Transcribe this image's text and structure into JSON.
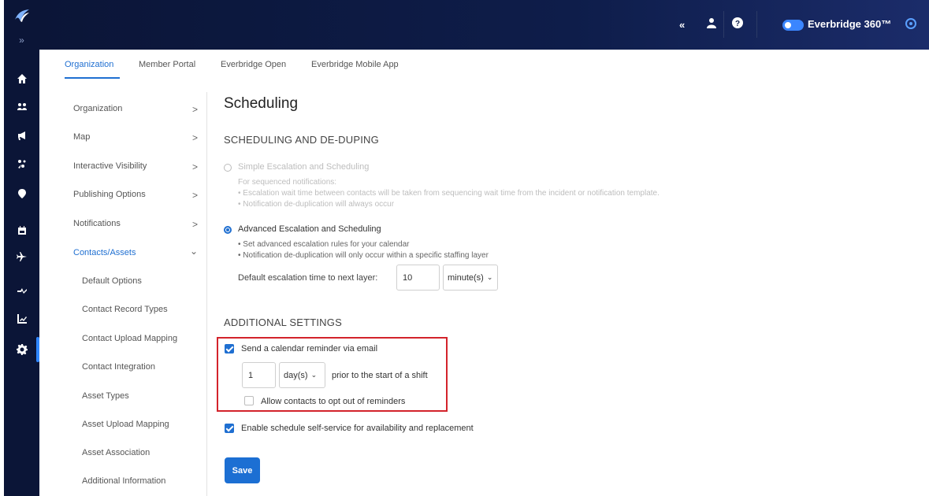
{
  "topbar": {
    "collapse_icon": "double-chevron-left-icon",
    "user_icon": "user-icon",
    "help_icon": "help-circle-icon",
    "brand": "Everbridge 360™",
    "toggle_on": true
  },
  "rail": {
    "items": [
      "home-icon",
      "group-icon",
      "megaphone-icon",
      "people-scatter-icon",
      "map-pin-icon",
      "calendar-icon",
      "plane-icon",
      "route-icon",
      "chart-icon",
      "gear-icon"
    ],
    "active_item": "gear-icon",
    "expand_glyph": "»"
  },
  "tabs": [
    "Organization",
    "Member Portal",
    "Everbridge Open",
    "Everbridge Mobile App"
  ],
  "active_tab": "Organization",
  "sidenav": {
    "items": [
      {
        "label": "Organization",
        "chevron": ">"
      },
      {
        "label": "Map",
        "chevron": ">"
      },
      {
        "label": "Interactive Visibility",
        "chevron": ">"
      },
      {
        "label": "Publishing Options",
        "chevron": ">"
      },
      {
        "label": "Notifications",
        "chevron": ">"
      },
      {
        "label": "Contacts/Assets",
        "chevron": "⌄"
      }
    ],
    "subitems": [
      "Default Options",
      "Contact Record Types",
      "Contact Upload Mapping",
      "Contact Integration",
      "Asset Types",
      "Asset Upload Mapping",
      "Asset Association",
      "Additional Information"
    ]
  },
  "main": {
    "title": "Scheduling",
    "section1": "SCHEDULING AND DE-DUPING",
    "simple": {
      "label": "Simple Escalation and Scheduling",
      "lines": [
        "For sequenced notifications:",
        "• Escalation wait time between contacts will be taken from sequencing wait time from the incident or notification template.",
        "• Notification de-duplication will always occur"
      ]
    },
    "advanced": {
      "label": "Advanced Escalation and Scheduling",
      "lines": [
        "• Set advanced escalation rules for your calendar",
        "• Notification de-duplication will only occur within a specific staffing layer"
      ],
      "field_label": "Default escalation time to next layer:",
      "value": "10",
      "unit": "minute(s)"
    },
    "section2": "ADDITIONAL SETTINGS",
    "reminder": {
      "label": "Send a calendar reminder via email",
      "value": "1",
      "unit": "day(s)",
      "suffix": "prior to the start of a shift",
      "opt_out": "Allow contacts to opt out of reminders"
    },
    "self_service": "Enable schedule self-service for availability and replacement",
    "save": "Save"
  }
}
